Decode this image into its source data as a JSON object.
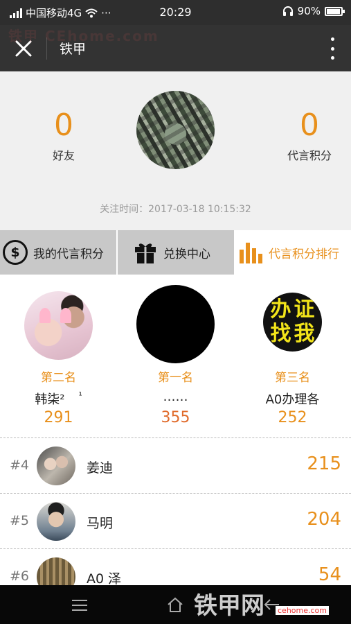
{
  "status_bar": {
    "carrier": "中国移动4G",
    "dots": "···",
    "time": "20:29",
    "battery": "90%",
    "battery_level": 0.9
  },
  "nav": {
    "title": "铁甲"
  },
  "profile": {
    "friends_count": "0",
    "friends_label": "好友",
    "points_count": "0",
    "points_label": "代言积分",
    "follow_time": "关注时间：2017-03-18 10:15:32"
  },
  "tabs": [
    {
      "label": "我的代言积分",
      "icon": "dollar-coin-icon"
    },
    {
      "label": "兑换中心",
      "icon": "gift-icon"
    },
    {
      "label": "代言积分排行",
      "icon": "bar-chart-icon"
    }
  ],
  "podium": {
    "second": {
      "rank": "第二名",
      "name": "韩柒²",
      "name_extra": "¹",
      "score": "291"
    },
    "first": {
      "rank": "第一名",
      "name": "……",
      "score": "355"
    },
    "third": {
      "rank": "第三名",
      "name": "A0办理各",
      "score": "252",
      "avatar_text": [
        "办",
        "证",
        "找",
        "我"
      ]
    }
  },
  "leaderboard": [
    {
      "rank": "#4",
      "name": "姜迪",
      "score": "215"
    },
    {
      "rank": "#5",
      "name": "马明",
      "score": "204"
    },
    {
      "rank": "#6",
      "name": "A0 泽",
      "score": "54"
    }
  ],
  "watermark": {
    "top": "铁甲 CEhome.com",
    "bottom": "铁甲网",
    "bottom_sub": "cehome.com"
  },
  "colors": {
    "accent": "#e8901c",
    "header_bg": "#333333",
    "first_score": "#e06a2a"
  }
}
